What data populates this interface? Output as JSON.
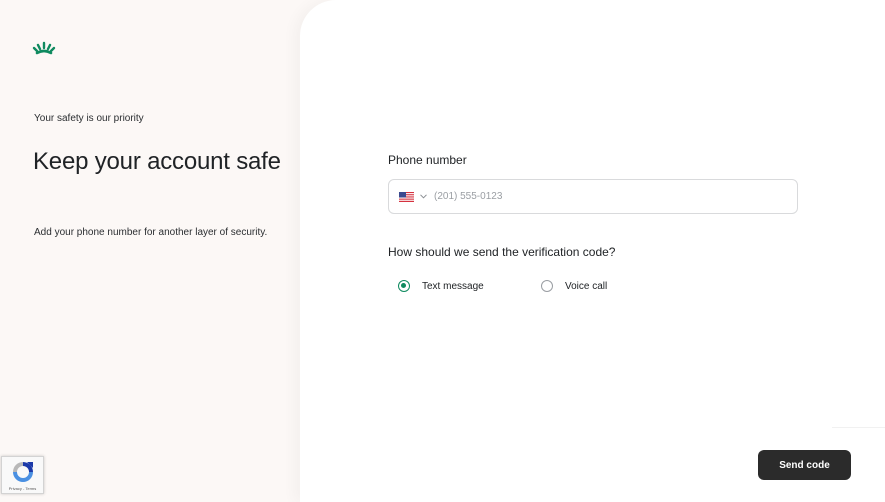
{
  "brand": {
    "logo_icon": "sprout-crown-logo-icon",
    "accent_color": "#0f8a5f"
  },
  "left": {
    "eyebrow": "Your safety is our priority",
    "headline": "Keep your account safe",
    "subtext": "Add your phone number for another layer of security."
  },
  "recaptcha": {
    "icon": "recaptcha-icon",
    "links": "Privacy - Terms"
  },
  "form": {
    "phone_label": "Phone number",
    "country_flag": "us-flag-icon",
    "phone_placeholder": "(201) 555-0123",
    "phone_value": "",
    "method_question": "How should we send the verification code?",
    "methods": [
      {
        "label": "Text message",
        "selected": true
      },
      {
        "label": "Voice call",
        "selected": false
      }
    ],
    "submit_label": "Send code"
  }
}
